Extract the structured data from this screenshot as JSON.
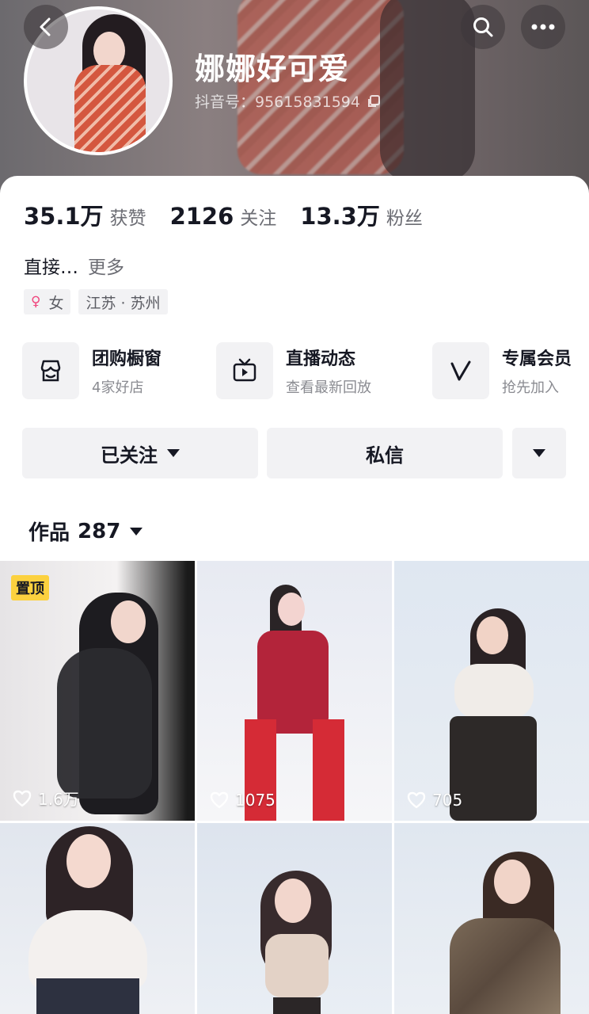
{
  "profile": {
    "name": "娜娜好可爱",
    "douyin_id_label": "抖音号：95615831594"
  },
  "stats": [
    {
      "num": "35.1万",
      "label": "获赞"
    },
    {
      "num": "2126",
      "label": "关注"
    },
    {
      "num": "13.3万",
      "label": "粉丝"
    }
  ],
  "bio": {
    "text": "直接…",
    "more": "更多"
  },
  "tags": {
    "gender_symbol": "♀",
    "gender": "女",
    "location": "江苏 · 苏州"
  },
  "features": [
    {
      "title": "团购橱窗",
      "sub": "4家好店",
      "icon": "shop-icon"
    },
    {
      "title": "直播动态",
      "sub": "查看最新回放",
      "icon": "live-tv-icon"
    },
    {
      "title": "专属会员",
      "sub": "抢先加入",
      "icon": "v-member-icon"
    }
  ],
  "buttons": {
    "followed": "已关注",
    "message": "私信"
  },
  "works": {
    "label": "作品",
    "count": "287"
  },
  "videos": [
    {
      "likes": "1.6万",
      "pinned": "置顶"
    },
    {
      "likes": "1075"
    },
    {
      "likes": "705"
    },
    {
      "likes": ""
    },
    {
      "likes": ""
    },
    {
      "likes": ""
    }
  ],
  "colors": {
    "pin_badge": "#fcd13f",
    "female": "#f0467d"
  }
}
